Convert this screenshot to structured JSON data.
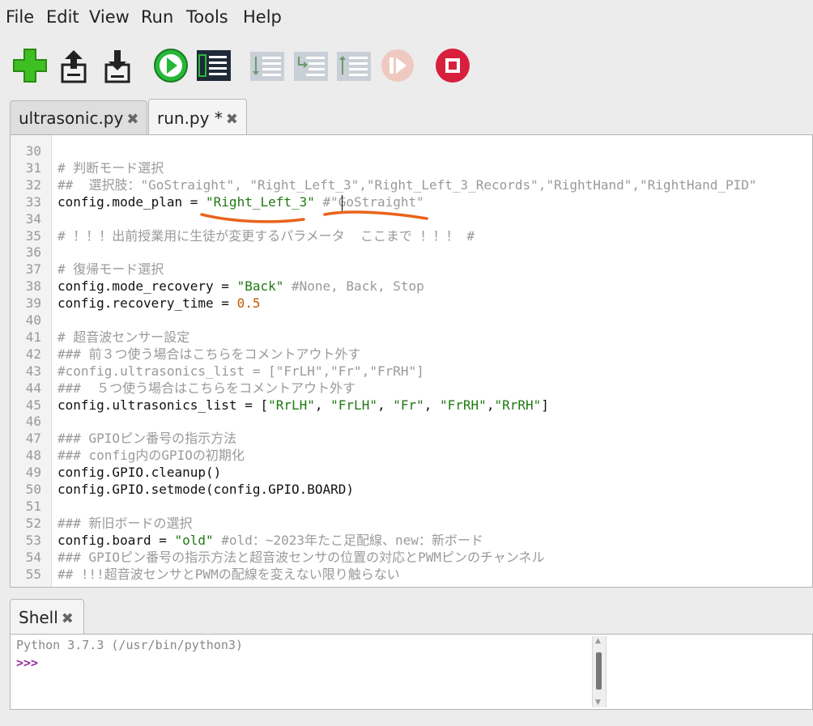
{
  "menu": [
    "File",
    "Edit",
    "View",
    "Run",
    "Tools",
    "Help"
  ],
  "toolbar": {
    "icons": [
      "new-file-icon",
      "open-file-icon",
      "save-file-icon",
      "run-icon",
      "debug-icon",
      "step-over-icon",
      "step-into-icon",
      "step-out-icon",
      "resume-icon",
      "stop-icon"
    ]
  },
  "editor_tabs": [
    {
      "label": "ultrasonic.py",
      "close": "✖"
    },
    {
      "label": "run.py *",
      "close": "✖"
    }
  ],
  "editor": {
    "line_numbers": [
      "30",
      "31",
      "32",
      "33",
      "34",
      "35",
      "36",
      "37",
      "38",
      "39",
      "40",
      "41",
      "42",
      "43",
      "44",
      "45",
      "46",
      "47",
      "48",
      "49",
      "50",
      "51",
      "52",
      "53",
      "54",
      "55"
    ],
    "lines": [
      [],
      [
        {
          "t": "# 判断モード選択",
          "c": "cm"
        }
      ],
      [
        {
          "t": "##  選択肢：\"GoStraight\", \"Right_Left_3\",\"Right_Left_3_Records\",\"RightHand\",\"RightHand_PID\"",
          "c": "cm"
        }
      ],
      [
        {
          "t": "config.mode_plan = ",
          "c": ""
        },
        {
          "t": "\"Right_Left_3\"",
          "c": "st"
        },
        {
          "t": " #\"GoStraight\"",
          "c": "cm"
        }
      ],
      [],
      [
        {
          "t": "# ！！！出前授業用に生徒が変更するパラメータ  ここまで ！！！ #",
          "c": "cm"
        }
      ],
      [],
      [
        {
          "t": "# 復帰モード選択",
          "c": "cm"
        }
      ],
      [
        {
          "t": "config.mode_recovery = ",
          "c": ""
        },
        {
          "t": "\"Back\"",
          "c": "st"
        },
        {
          "t": " #None, Back, Stop",
          "c": "cm"
        }
      ],
      [
        {
          "t": "config.recovery_time = ",
          "c": ""
        },
        {
          "t": "0.5",
          "c": "nm"
        }
      ],
      [],
      [
        {
          "t": "# 超音波センサー設定",
          "c": "cm"
        }
      ],
      [
        {
          "t": "### 前３つ使う場合はこちらをコメントアウト外す",
          "c": "cm"
        }
      ],
      [
        {
          "t": "#config.ultrasonics_list = [\"FrLH\",\"Fr\",\"FrRH\"]",
          "c": "cm"
        }
      ],
      [
        {
          "t": "###  ５つ使う場合はこちらをコメントアウト外す",
          "c": "cm"
        }
      ],
      [
        {
          "t": "config.ultrasonics_list = [",
          "c": ""
        },
        {
          "t": "\"RrLH\"",
          "c": "st"
        },
        {
          "t": ", ",
          "c": ""
        },
        {
          "t": "\"FrLH\"",
          "c": "st"
        },
        {
          "t": ", ",
          "c": ""
        },
        {
          "t": "\"Fr\"",
          "c": "st"
        },
        {
          "t": ", ",
          "c": ""
        },
        {
          "t": "\"FrRH\"",
          "c": "st"
        },
        {
          "t": ",",
          "c": ""
        },
        {
          "t": "\"RrRH\"",
          "c": "st"
        },
        {
          "t": "]",
          "c": ""
        }
      ],
      [],
      [
        {
          "t": "### GPIOピン番号の指示方法",
          "c": "cm"
        }
      ],
      [
        {
          "t": "### config内のGPIOの初期化",
          "c": "cm"
        }
      ],
      [
        {
          "t": "config.GPIO.cleanup()",
          "c": ""
        }
      ],
      [
        {
          "t": "config.GPIO.setmode(config.GPIO.BOARD)",
          "c": ""
        }
      ],
      [],
      [
        {
          "t": "### 新旧ボードの選択",
          "c": "cm"
        }
      ],
      [
        {
          "t": "config.board = ",
          "c": ""
        },
        {
          "t": "\"old\"",
          "c": "st"
        },
        {
          "t": " #old：~2023年たこ足配線、new：新ボード",
          "c": "cm"
        }
      ],
      [
        {
          "t": "### GPIOピン番号の指示方法と超音波センサの位置の対応とPWMピンのチャンネル",
          "c": "cm"
        }
      ],
      [
        {
          "t": "## !!!超音波センサとPWMの配線を変えない限り触らない",
          "c": "cm"
        }
      ]
    ]
  },
  "shell": {
    "tab_label": "Shell",
    "close": "✖",
    "banner": "Python 3.7.3 (/usr/bin/python3)",
    "prompt": ">>>"
  },
  "colors": {
    "string": "#1f7a12",
    "comment": "#9a9a9a",
    "number": "#c05a00",
    "annotation": "#e8641b",
    "prompt": "#9b2d9b"
  }
}
